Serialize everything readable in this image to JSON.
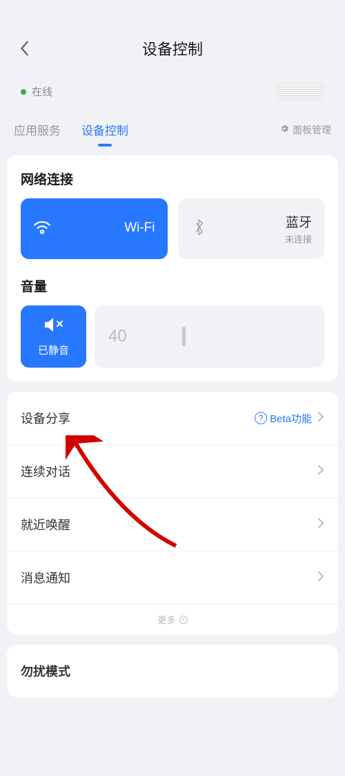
{
  "header": {
    "title": "设备控制"
  },
  "status": {
    "online_label": "在线"
  },
  "tabs": {
    "app_services": "应用服务",
    "device_control": "设备控制",
    "panel_management": "面板管理"
  },
  "network": {
    "section_title": "网络连接",
    "wifi": {
      "name": "Wi-Fi",
      "sub": ""
    },
    "bluetooth": {
      "name": "蓝牙",
      "sub": "未连接"
    }
  },
  "volume": {
    "section_title": "音量",
    "mute_label": "已静音",
    "value": "40"
  },
  "list": {
    "device_share": "设备分享",
    "beta_label": "Beta功能",
    "continuous_dialog": "连续对话",
    "nearby_wake": "就近唤醒",
    "message_notify": "消息通知",
    "more": "更多"
  },
  "dnd": {
    "title": "勿扰模式"
  }
}
